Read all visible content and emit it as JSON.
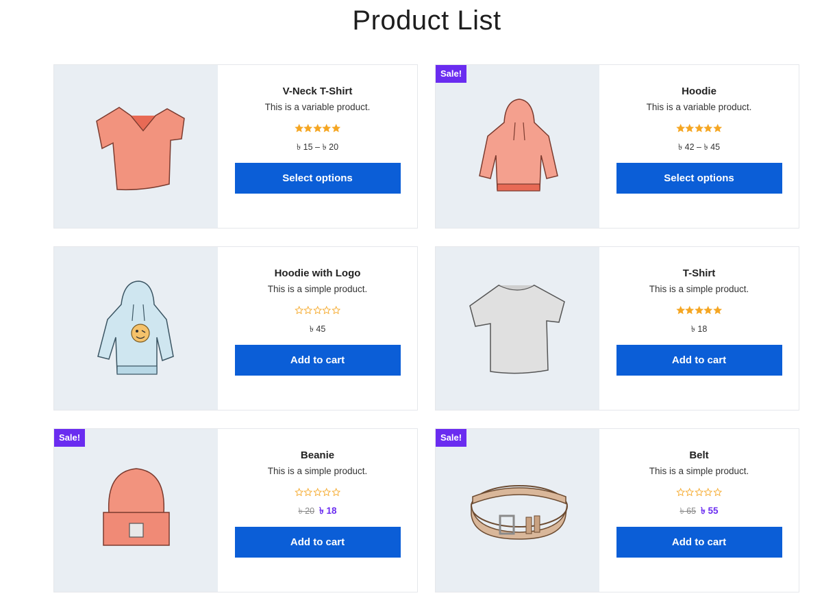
{
  "page": {
    "title": "Product List"
  },
  "colors": {
    "button": "#0b5ed7",
    "sale_badge": "#6a2cf0",
    "star": "#f5a623",
    "image_bg": "#e9eef3"
  },
  "products": [
    {
      "name": "V-Neck T-Shirt",
      "description": "This is a variable product.",
      "rating": 5,
      "price": "৳ 15 – ৳ 20",
      "button": "Select options",
      "sale": false,
      "image_icon": "vneck-tshirt-icon"
    },
    {
      "name": "Hoodie",
      "description": "This is a variable product.",
      "rating": 5,
      "price": "৳ 42 – ৳ 45",
      "button": "Select options",
      "sale": true,
      "sale_label": "Sale!",
      "image_icon": "hoodie-icon"
    },
    {
      "name": "Hoodie with Logo",
      "description": "This is a simple product.",
      "rating": 0,
      "price": "৳ 45",
      "button": "Add to cart",
      "sale": false,
      "image_icon": "hoodie-logo-icon"
    },
    {
      "name": "T-Shirt",
      "description": "This is a simple product.",
      "rating": 5,
      "price": "৳ 18",
      "button": "Add to cart",
      "sale": false,
      "image_icon": "tshirt-icon"
    },
    {
      "name": "Beanie",
      "description": "This is a simple product.",
      "rating": 0,
      "old_price": "৳ 20",
      "price": "৳ 18",
      "button": "Add to cart",
      "sale": true,
      "sale_label": "Sale!",
      "image_icon": "beanie-icon"
    },
    {
      "name": "Belt",
      "description": "This is a simple product.",
      "rating": 0,
      "old_price": "৳ 65",
      "price": "৳ 55",
      "button": "Add to cart",
      "sale": true,
      "sale_label": "Sale!",
      "image_icon": "belt-icon"
    }
  ]
}
